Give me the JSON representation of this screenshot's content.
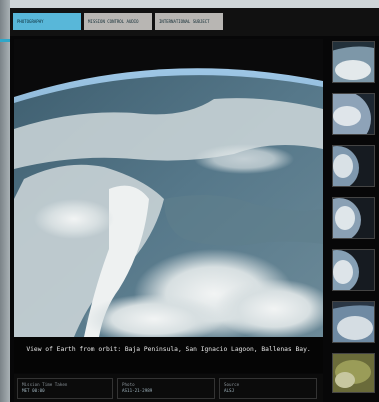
{
  "tabs": [
    {
      "label": "PHOTOGRAPHY",
      "active": true
    },
    {
      "label": "MISSION CONTROL AUDIO",
      "active": false
    },
    {
      "label": "INTERNATIONAL SUBJECT",
      "active": false
    }
  ],
  "viewer": {
    "caption": "View of Earth from orbit: Baja Peninsula, San Ignacio Lagoon, Ballenas Bay."
  },
  "meta": [
    {
      "label": "Mission Time Taken",
      "value": "MET 00:00"
    },
    {
      "label": "Photo",
      "value": "AS11-21-2989"
    },
    {
      "label": "Source",
      "value": "ALSJ"
    }
  ],
  "thumbnails": [
    {
      "name": "thumb-1",
      "icon": "earth-thumbnail"
    },
    {
      "name": "thumb-2",
      "icon": "earth-thumbnail"
    },
    {
      "name": "thumb-3",
      "icon": "earth-thumbnail"
    },
    {
      "name": "thumb-4",
      "icon": "earth-thumbnail"
    },
    {
      "name": "thumb-5",
      "icon": "earth-thumbnail"
    },
    {
      "name": "thumb-6",
      "icon": "earth-thumbnail"
    },
    {
      "name": "thumb-7",
      "icon": "earth-thumbnail"
    }
  ],
  "colors": {
    "accent": "#58b7d9",
    "tab_inactive": "#b8b6b3",
    "background": "#070708"
  }
}
